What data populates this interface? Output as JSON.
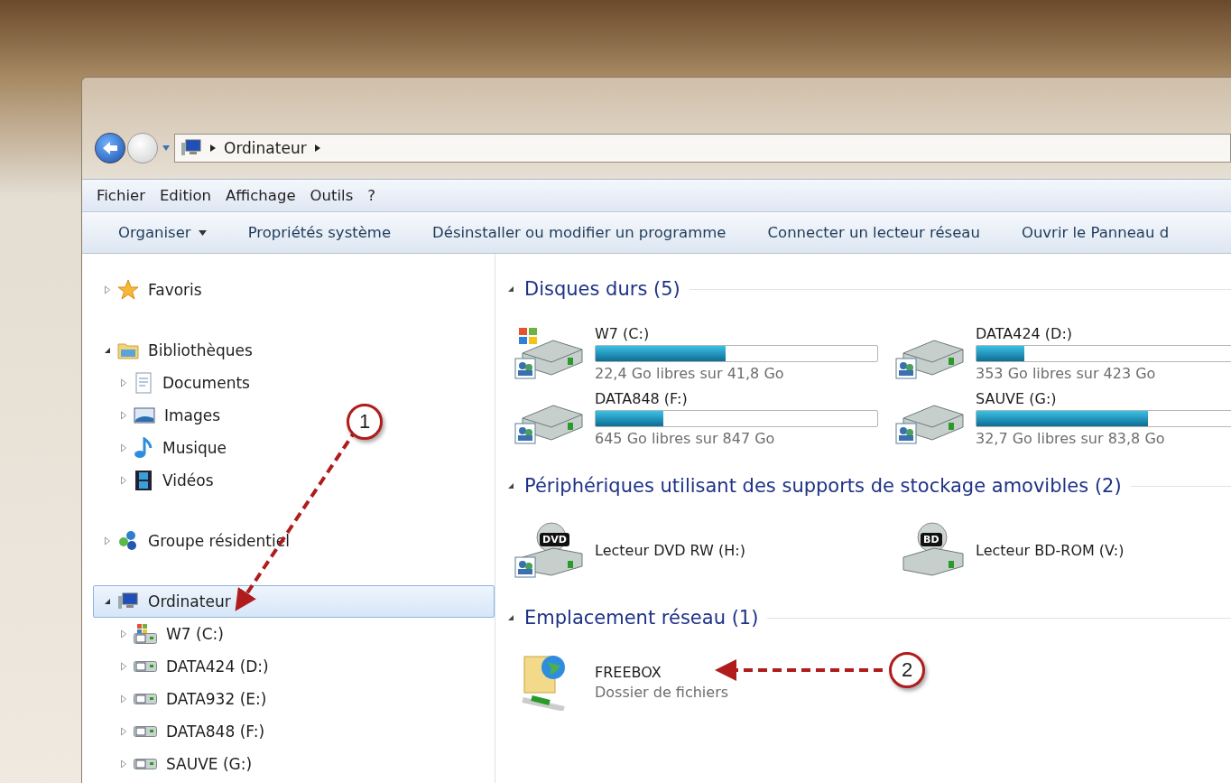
{
  "address": {
    "crumbs": [
      {
        "label": "Ordinateur"
      }
    ]
  },
  "menu": [
    "Fichier",
    "Edition",
    "Affichage",
    "Outils",
    "?"
  ],
  "toolbar": [
    {
      "label": "Organiser",
      "kind": "dropdown"
    },
    {
      "label": "Propriétés système",
      "kind": "command"
    },
    {
      "label": "Désinstaller ou modifier un programme",
      "kind": "command"
    },
    {
      "label": "Connecter un lecteur réseau",
      "kind": "command"
    },
    {
      "label": "Ouvrir le Panneau d",
      "kind": "command"
    }
  ],
  "nav": [
    {
      "label": "Favoris",
      "kind": "star",
      "expanded": false,
      "selected": false
    },
    {
      "label": "Bibliothèques",
      "kind": "library",
      "expanded": true,
      "selected": false,
      "children": [
        {
          "label": "Documents",
          "kind": "document",
          "expanded": false,
          "selected": false
        },
        {
          "label": "Images",
          "kind": "image",
          "expanded": false,
          "selected": false
        },
        {
          "label": "Musique",
          "kind": "music",
          "expanded": false,
          "selected": false
        },
        {
          "label": "Vidéos",
          "kind": "video",
          "expanded": false,
          "selected": false
        }
      ]
    },
    {
      "label": "Groupe résidentiel",
      "kind": "homegroup",
      "expanded": false,
      "selected": false
    },
    {
      "label": "Ordinateur",
      "kind": "computer",
      "expanded": true,
      "selected": true,
      "children": [
        {
          "label": "W7 (C:)",
          "kind": "system-drive",
          "expanded": false,
          "selected": false
        },
        {
          "label": "DATA424 (D:)",
          "kind": "drive",
          "expanded": false,
          "selected": false
        },
        {
          "label": "DATA932 (E:)",
          "kind": "drive",
          "expanded": false,
          "selected": false
        },
        {
          "label": "DATA848 (F:)",
          "kind": "drive",
          "expanded": false,
          "selected": false
        },
        {
          "label": "SAUVE (G:)",
          "kind": "drive",
          "expanded": false,
          "selected": false
        }
      ]
    }
  ],
  "groups": [
    {
      "title": "Disques durs (5)",
      "expanded": true,
      "items": [
        {
          "kind": "drive",
          "name": "W7 (C:)",
          "system": true,
          "shared": true,
          "level": 0.46,
          "free": "22,4 Go libres sur 41,8 Go"
        },
        {
          "kind": "drive",
          "name": "DATA424 (D:)",
          "system": false,
          "shared": true,
          "level": 0.17,
          "free": "353 Go libres sur 423 Go"
        },
        {
          "kind": "drive",
          "name": "DATA848 (F:)",
          "system": false,
          "shared": true,
          "level": 0.24,
          "free": "645 Go libres sur 847 Go"
        },
        {
          "kind": "drive",
          "name": "SAUVE (G:)",
          "system": false,
          "shared": true,
          "level": 0.61,
          "free": "32,7 Go libres sur 83,8 Go"
        }
      ]
    },
    {
      "title": "Périphériques utilisant des supports de stockage amovibles (2)",
      "expanded": true,
      "items": [
        {
          "kind": "optical",
          "name": "Lecteur DVD RW (H:)",
          "badge": "DVD",
          "shared": true
        },
        {
          "kind": "optical",
          "name": "Lecteur BD-ROM (V:)",
          "badge": "BD",
          "shared": false
        }
      ]
    },
    {
      "title": "Emplacement réseau (1)",
      "expanded": true,
      "items": [
        {
          "kind": "network",
          "name": "FREEBOX",
          "subtitle": "Dossier de fichiers"
        }
      ]
    }
  ],
  "callouts": [
    {
      "number": "1"
    },
    {
      "number": "2"
    }
  ]
}
